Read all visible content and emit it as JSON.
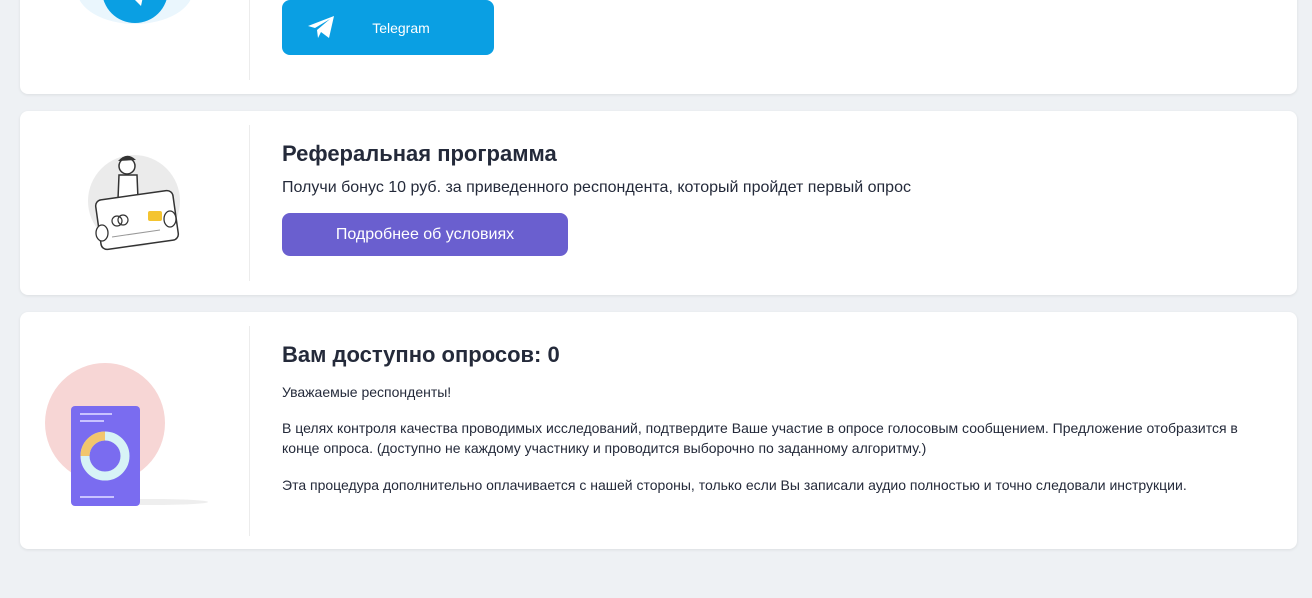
{
  "telegram_card": {
    "button_label": "Telegram"
  },
  "referral_card": {
    "title": "Реферальная программа",
    "description": "Получи бонус 10 руб. за приведенного респондента, который пройдет первый опрос",
    "button_label": "Подробнее об условиях"
  },
  "surveys_card": {
    "title": "Вам доступно опросов: 0",
    "greeting": "Уважаемые респонденты!",
    "paragraph1": "В целях контроля качества проводимых исследований, подтвердите Ваше участие в опросе голосовым сообщением. Предложение отобразится в конце опроса. (доступно не каждому участнику и проводится выборочно по заданному алгоритму.)",
    "paragraph2": "Эта процедура дополнительно оплачивается с нашей стороны, только если Вы записали аудио полностью и точно следовали инструкции."
  },
  "colors": {
    "page_bg": "#eef1f4",
    "telegram_blue": "#0a9fe3",
    "accent_purple": "#6a5fcf",
    "title_text": "#242a3a"
  },
  "icons": {
    "telegram_button_icon": "paper-plane-icon",
    "telegram_illustration": "telegram-logo-icon",
    "referral_illustration": "person-holding-card-illustration",
    "surveys_illustration": "phone-chart-illustration"
  }
}
